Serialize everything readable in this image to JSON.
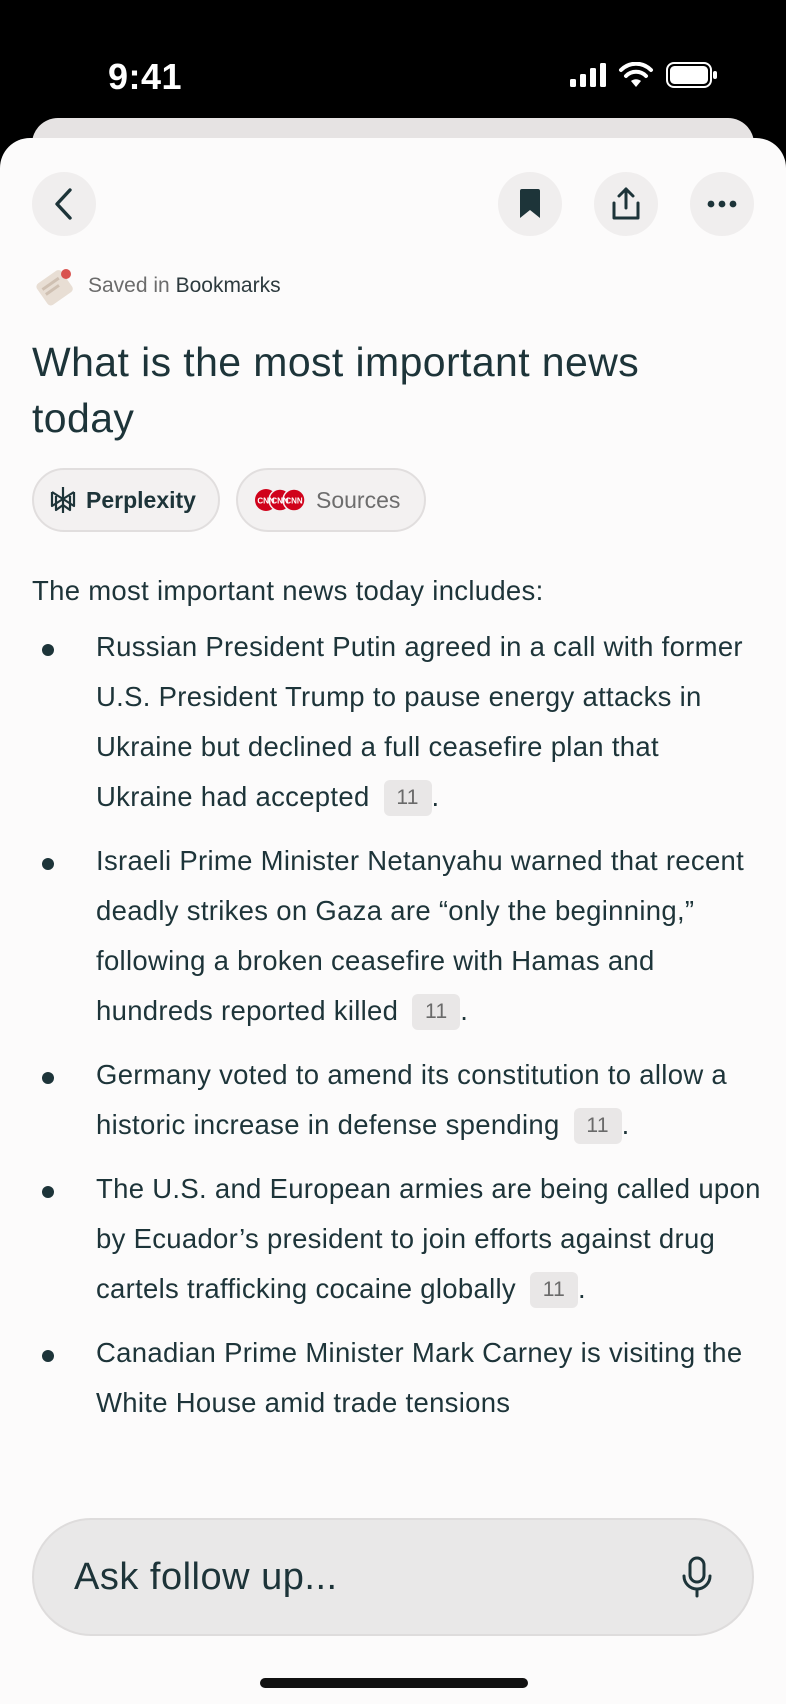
{
  "status_bar": {
    "time": "9:41"
  },
  "nav": {
    "back_icon": "chevron-left-icon",
    "bookmark_icon": "bookmark-icon",
    "share_icon": "share-icon",
    "more_icon": "ellipsis-icon"
  },
  "saved": {
    "prefix": "Saved in",
    "collection": "Bookmarks"
  },
  "title": "What is the most important news today",
  "chips": [
    {
      "label": "Perplexity",
      "icon": "perplexity-logo-icon"
    },
    {
      "label": "Sources",
      "icon": "source-favicons-icon"
    }
  ],
  "answer": {
    "intro": "The most important news today includes:",
    "bullets": [
      {
        "text": "Russian President Putin agreed in a call with former U.S. President Trump to pause energy attacks in Ukraine but declined a full ceasefire plan that Ukraine had accepted",
        "cite": "11",
        "tail": "."
      },
      {
        "text": "Israeli Prime Minister Netanyahu warned that recent deadly strikes on Gaza are “only the beginning,” following a broken ceasefire with Hamas and hundreds reported killed",
        "cite": "11",
        "tail": "."
      },
      {
        "text": "Germany voted to amend its constitution to allow a historic increase in defense spending",
        "cite": "11",
        "tail": "."
      },
      {
        "text": "The U.S. and European armies are being called upon by Ecuador’s president to join efforts against drug cartels trafficking cocaine globally",
        "cite": "11",
        "tail": "."
      },
      {
        "text": "Canadian Prime Minister Mark Carney is visiting the White House amid trade tensions",
        "cite": "",
        "tail": ""
      }
    ]
  },
  "ask": {
    "placeholder": "Ask follow up...",
    "mic_icon": "microphone-icon"
  },
  "colors": {
    "text": "#1d3439",
    "sheet": "#fcfbfb",
    "button": "#f0eeee",
    "source_red": "#d0021b"
  }
}
